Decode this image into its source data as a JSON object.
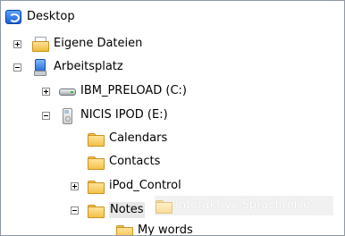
{
  "tree": {
    "items": [
      {
        "label": "Desktop"
      },
      {
        "label": "Eigene Dateien"
      },
      {
        "label": "Arbeitsplatz"
      },
      {
        "label": "IBM_PRELOAD (C:)"
      },
      {
        "label": "NICIS IPOD (E:)"
      },
      {
        "label": "Calendars"
      },
      {
        "label": "Contacts"
      },
      {
        "label": "iPod_Control"
      },
      {
        "label": "Notes"
      },
      {
        "label": "My words"
      }
    ]
  },
  "drag_ghost": {
    "label": "Interaktive Sprachreise"
  }
}
